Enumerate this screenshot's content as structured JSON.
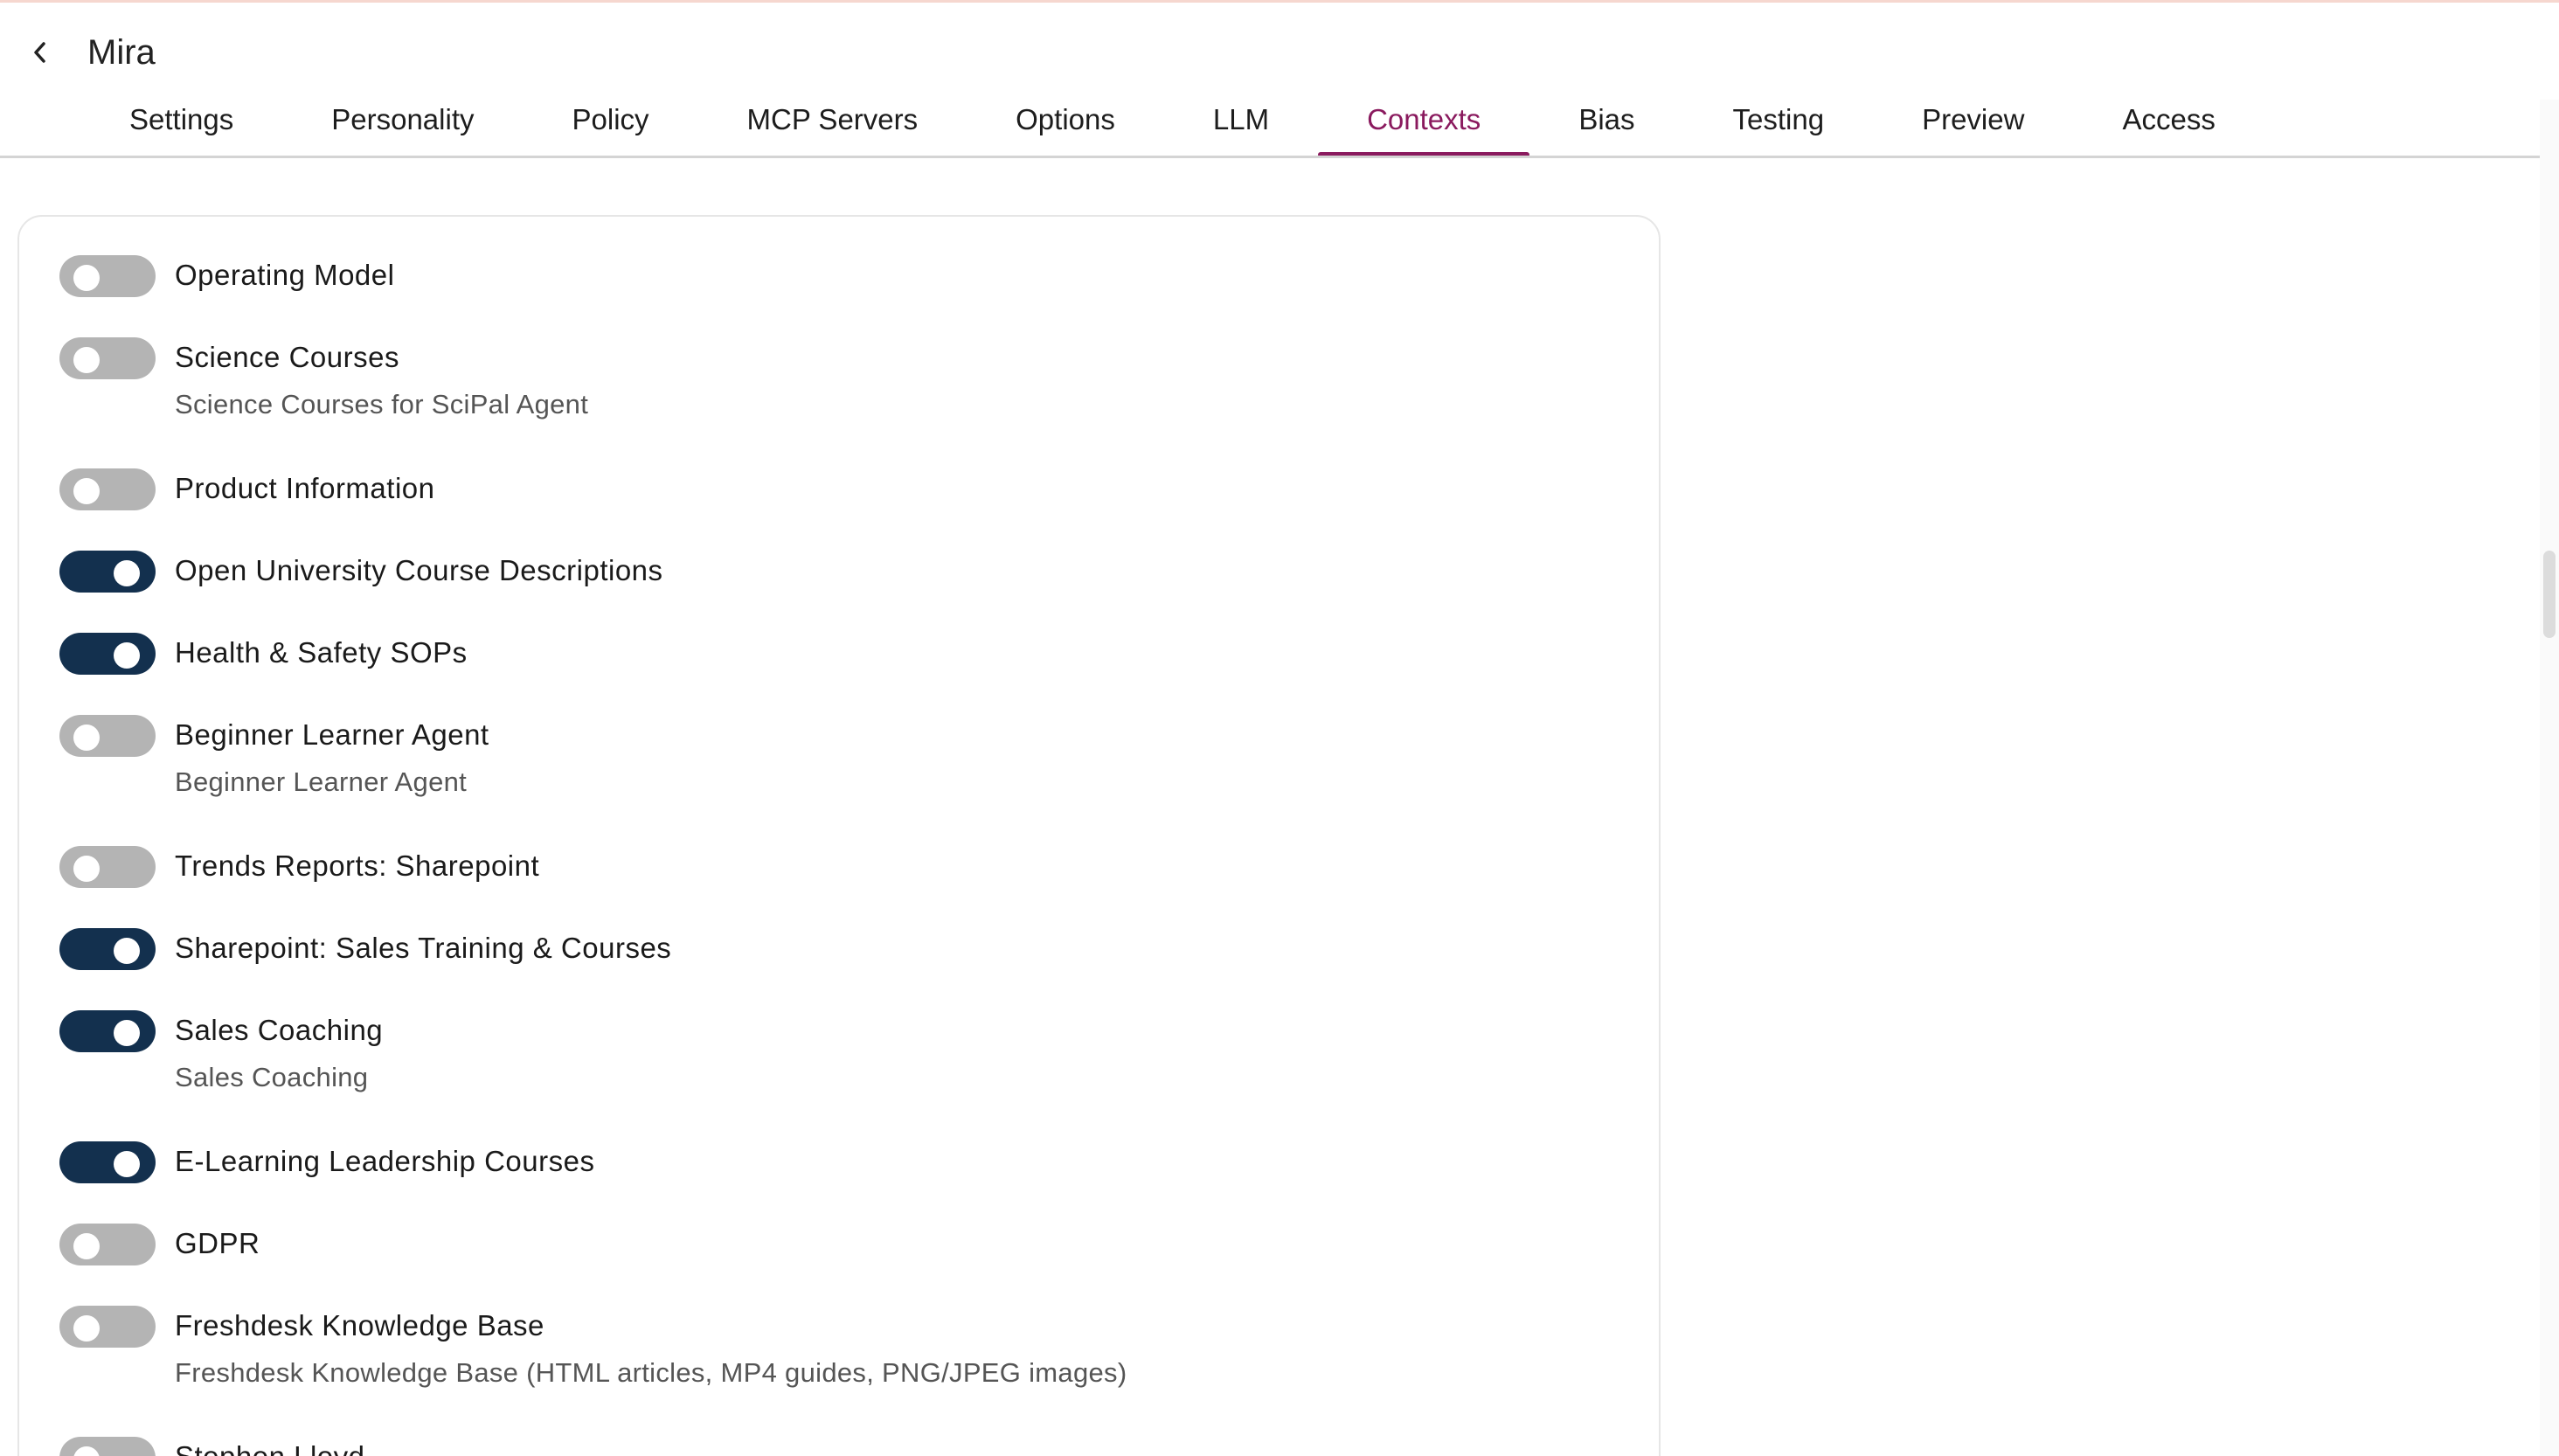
{
  "window": {
    "title": "Mira",
    "back_icon": "chevron-left-icon"
  },
  "tabs": [
    {
      "label": "Settings",
      "active": false
    },
    {
      "label": "Personality",
      "active": false
    },
    {
      "label": "Policy",
      "active": false
    },
    {
      "label": "MCP Servers",
      "active": false
    },
    {
      "label": "Options",
      "active": false
    },
    {
      "label": "LLM",
      "active": false
    },
    {
      "label": "Contexts",
      "active": true
    },
    {
      "label": "Bias",
      "active": false
    },
    {
      "label": "Testing",
      "active": false
    },
    {
      "label": "Preview",
      "active": false
    },
    {
      "label": "Access",
      "active": false
    }
  ],
  "colors": {
    "accent": "#8a1a5e",
    "toggle_on": "#13304e",
    "toggle_off": "#b4b4b4"
  },
  "contexts": [
    {
      "name": "Operating Model",
      "description": "",
      "enabled": false
    },
    {
      "name": "Science Courses",
      "description": "Science Courses for SciPal Agent",
      "enabled": false
    },
    {
      "name": "Product Information",
      "description": "",
      "enabled": false
    },
    {
      "name": "Open University Course Descriptions",
      "description": "",
      "enabled": true
    },
    {
      "name": "Health & Safety SOPs",
      "description": "",
      "enabled": true
    },
    {
      "name": "Beginner Learner Agent",
      "description": "Beginner Learner Agent",
      "enabled": false
    },
    {
      "name": "Trends Reports: Sharepoint",
      "description": "",
      "enabled": false
    },
    {
      "name": "Sharepoint: Sales Training & Courses",
      "description": "",
      "enabled": true
    },
    {
      "name": "Sales Coaching",
      "description": "Sales Coaching",
      "enabled": true
    },
    {
      "name": "E-Learning Leadership Courses",
      "description": "",
      "enabled": true
    },
    {
      "name": "GDPR",
      "description": "",
      "enabled": false
    },
    {
      "name": "Freshdesk Knowledge Base",
      "description": "Freshdesk Knowledge Base (HTML articles, MP4 guides, PNG/JPEG images)",
      "enabled": false
    },
    {
      "name": "Stephen Lloyd",
      "description": "",
      "enabled": false
    }
  ]
}
